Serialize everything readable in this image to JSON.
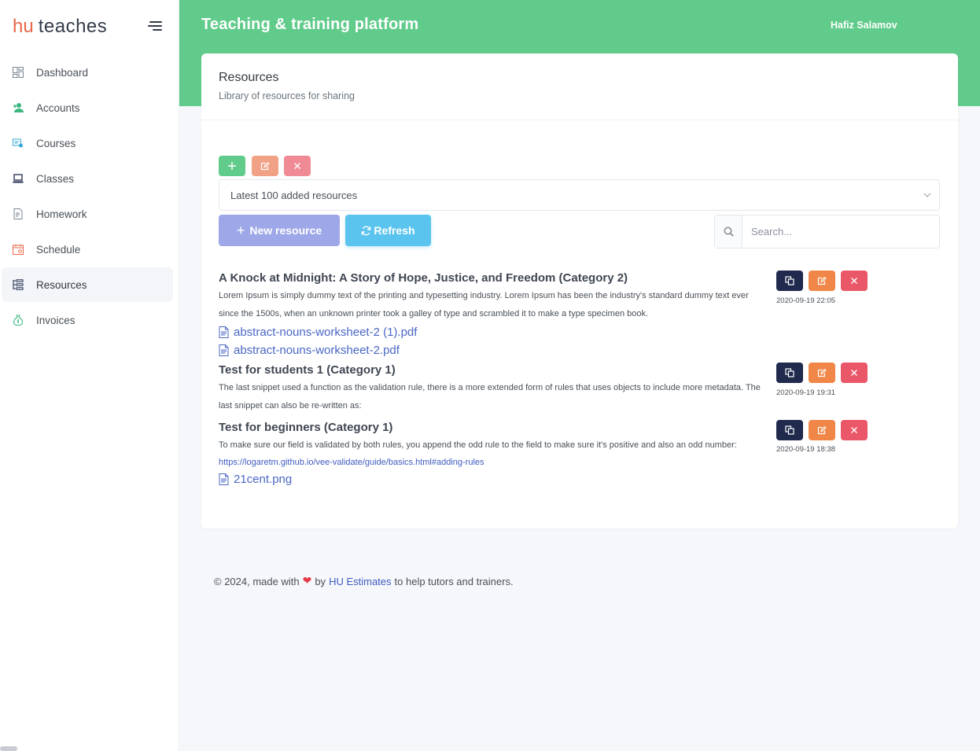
{
  "brand": {
    "hu": "hu",
    "name": "teaches"
  },
  "header": {
    "title": "Teaching & training platform",
    "user": "Hafiz Salamov"
  },
  "sidebar": {
    "items": [
      {
        "label": "Dashboard",
        "icon": "dashboard-icon"
      },
      {
        "label": "Accounts",
        "icon": "user-plus-icon"
      },
      {
        "label": "Courses",
        "icon": "courses-icon"
      },
      {
        "label": "Classes",
        "icon": "laptop-icon"
      },
      {
        "label": "Homework",
        "icon": "homework-icon"
      },
      {
        "label": "Schedule",
        "icon": "calendar-icon"
      },
      {
        "label": "Resources",
        "icon": "resources-icon",
        "active": true
      },
      {
        "label": "Invoices",
        "icon": "money-bag-icon"
      }
    ]
  },
  "card": {
    "title": "Resources",
    "subtitle": "Library of resources for sharing"
  },
  "filter": {
    "selected": "Latest 100 added resources"
  },
  "toolbar": {
    "new_label": "New resource",
    "refresh_label": "Refresh",
    "search_placeholder": "Search..."
  },
  "resources": [
    {
      "title": "A Knock at Midnight: A Story of Hope, Justice, and Freedom (Category 2)",
      "description": "Lorem Ipsum is simply dummy text of the printing and typesetting industry. Lorem Ipsum has been the industry's standard dummy text ever since the 1500s, when an unknown printer took a galley of type and scrambled it to make a type specimen book.",
      "link": "",
      "files": [
        "abstract-nouns-worksheet-2 (1).pdf",
        "abstract-nouns-worksheet-2.pdf"
      ],
      "date": "2020-09-19 22:05"
    },
    {
      "title": "Test for students 1 (Category 1)",
      "description": "The last snippet used a function as the validation rule, there is a more extended form of rules that uses objects to include more metadata. The last snippet can also be re-written as:",
      "link": "",
      "files": [],
      "date": "2020-09-19 19:31"
    },
    {
      "title": "Test for beginners (Category 1)",
      "description": "To make sure our field is validated by both rules, you append the odd rule to the field to make sure it's positive and also an odd number:",
      "link": "https://logaretm.github.io/vee-validate/guide/basics.html#adding-rules",
      "files": [
        "21cent.png"
      ],
      "date": "2020-09-19 18:38"
    }
  ],
  "footer": {
    "prefix": "© 2024, made with",
    "by": "by",
    "company": "HU Estimates",
    "suffix": "to help tutors and trainers."
  },
  "colors": {
    "accent": "#60cb8a",
    "primary": "#9ea7e8",
    "info": "#5bc4ee",
    "warning": "#f08748",
    "danger": "#ea5768",
    "dark": "#1f2a4d",
    "brand": "#e8684a"
  }
}
